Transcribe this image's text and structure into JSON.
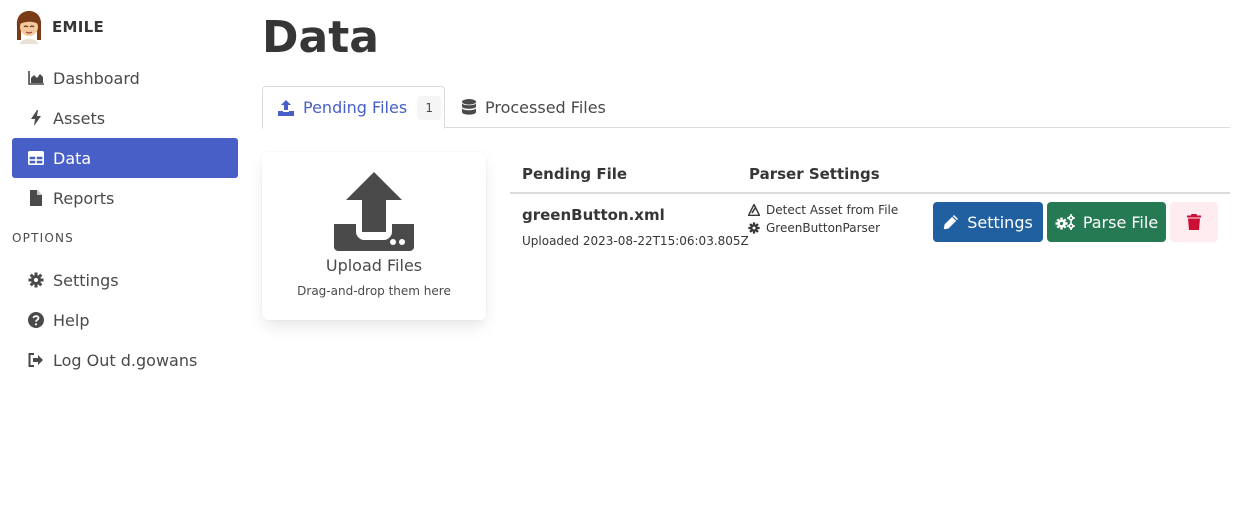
{
  "app": {
    "name": "EMILE"
  },
  "sidebar": {
    "items": [
      {
        "label": "Dashboard",
        "icon": "chart-area-icon"
      },
      {
        "label": "Assets",
        "icon": "bolt-icon"
      },
      {
        "label": "Data",
        "icon": "table-icon",
        "active": true
      },
      {
        "label": "Reports",
        "icon": "file-icon"
      }
    ],
    "options_label": "OPTIONS",
    "options": [
      {
        "label": "Settings",
        "icon": "gear-icon"
      },
      {
        "label": "Help",
        "icon": "question-circle-icon"
      },
      {
        "label": "Log Out d.gowans",
        "icon": "sign-out-icon"
      }
    ]
  },
  "page": {
    "title": "Data"
  },
  "tabs": [
    {
      "label": "Pending Files",
      "count": "1",
      "icon": "upload-icon",
      "active": true
    },
    {
      "label": "Processed Files",
      "icon": "database-icon"
    }
  ],
  "upload": {
    "title": "Upload Files",
    "subtitle": "Drag-and-drop them here"
  },
  "table": {
    "headers": [
      "Pending File",
      "Parser Settings"
    ],
    "rows": [
      {
        "file_name": "greenButton.xml",
        "uploaded": "Uploaded 2023-08-22T15:06:03.805Z",
        "parser_settings": [
          "Detect Asset from File",
          "GreenButtonParser"
        ]
      }
    ]
  },
  "actions": {
    "settings": "Settings",
    "parse": "Parse File"
  },
  "colors": {
    "accent": "#485fc7",
    "settings_button": "#2160a0",
    "parse_button": "#257953",
    "delete_bg": "#feecf0",
    "delete_icon": "#cc0f35"
  }
}
